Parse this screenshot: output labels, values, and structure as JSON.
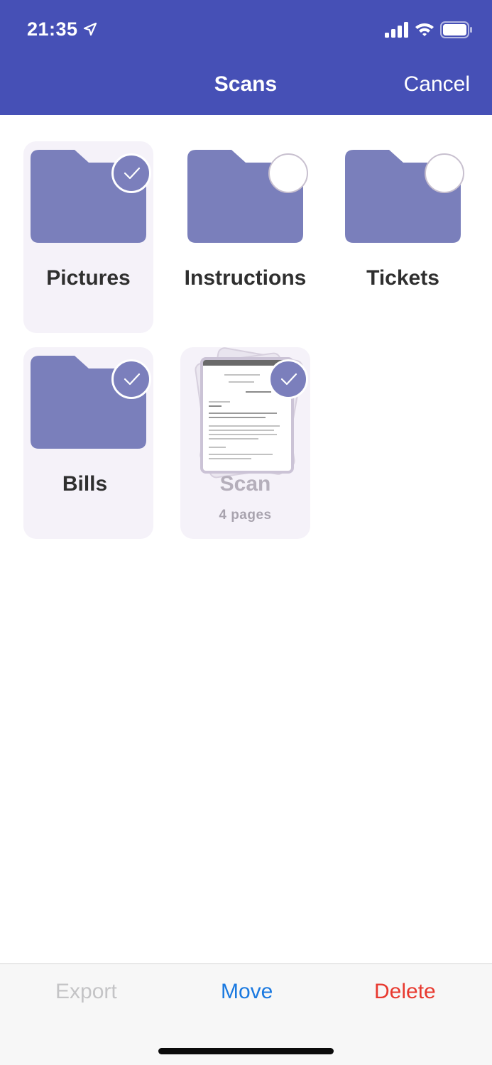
{
  "status": {
    "time": "21:35"
  },
  "nav": {
    "title": "Scans",
    "cancel_label": "Cancel"
  },
  "colors": {
    "header": "#4650b6",
    "folder": "#7a7fbb",
    "move": "#1a79e0",
    "delete": "#e8392f",
    "export_disabled": "#c4c4c6"
  },
  "items": [
    {
      "label": "Pictures",
      "type": "folder",
      "selected": true
    },
    {
      "label": "Instructions",
      "type": "folder",
      "selected": false
    },
    {
      "label": "Tickets",
      "type": "folder",
      "selected": false
    },
    {
      "label": "Bills",
      "type": "folder",
      "selected": true
    },
    {
      "label": "Scan",
      "type": "document",
      "subtitle": "4 pages",
      "selected": true
    }
  ],
  "toolbar": {
    "export_label": "Export",
    "move_label": "Move",
    "delete_label": "Delete"
  }
}
